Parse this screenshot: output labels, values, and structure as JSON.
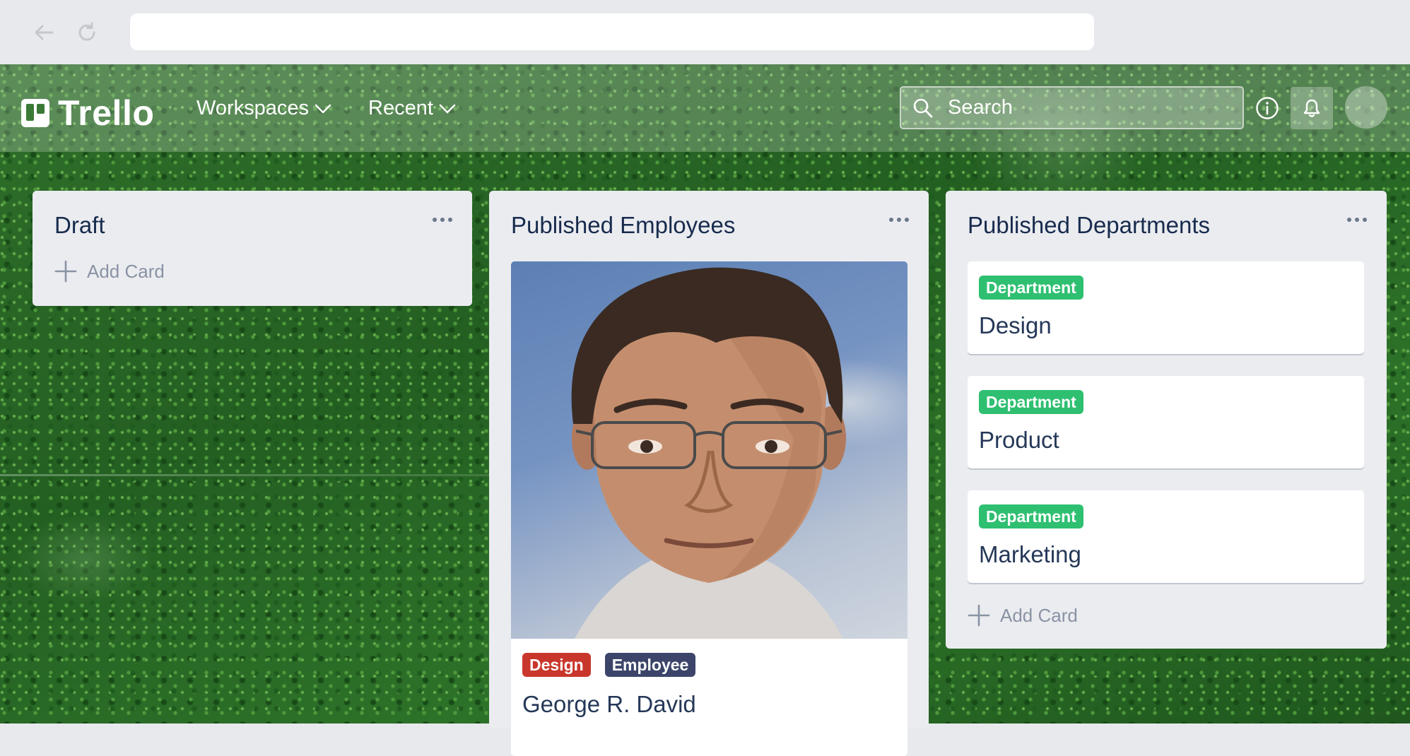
{
  "browser": {
    "back_icon": "arrow-left-icon",
    "reload_icon": "reload-icon",
    "address": ""
  },
  "header": {
    "logo_text": "Trello",
    "menu": [
      {
        "label": "Workspaces",
        "icon": "chevron-down-icon"
      },
      {
        "label": "Recent",
        "icon": "chevron-down-icon"
      }
    ],
    "search_placeholder": "Search",
    "info_icon": "info-icon",
    "bell_icon": "bell-icon"
  },
  "lists": [
    {
      "title": "Draft",
      "add_card": "Add Card",
      "cards": []
    },
    {
      "title": "Published Employees",
      "cards": [
        {
          "image": "employee-photo",
          "labels": [
            {
              "text": "Design",
              "color": "#c9372c"
            },
            {
              "text": "Employee",
              "color": "#3c4569"
            }
          ],
          "title": "George R. David"
        }
      ]
    },
    {
      "title": "Published Departments",
      "add_card": "Add Card",
      "cards": [
        {
          "labels": [
            {
              "text": "Department",
              "color": "#2fbf71"
            }
          ],
          "title": "Design"
        },
        {
          "labels": [
            {
              "text": "Department",
              "color": "#2fbf71"
            }
          ],
          "title": "Product"
        },
        {
          "labels": [
            {
              "text": "Department",
              "color": "#2fbf71"
            }
          ],
          "title": "Marketing"
        }
      ]
    }
  ]
}
